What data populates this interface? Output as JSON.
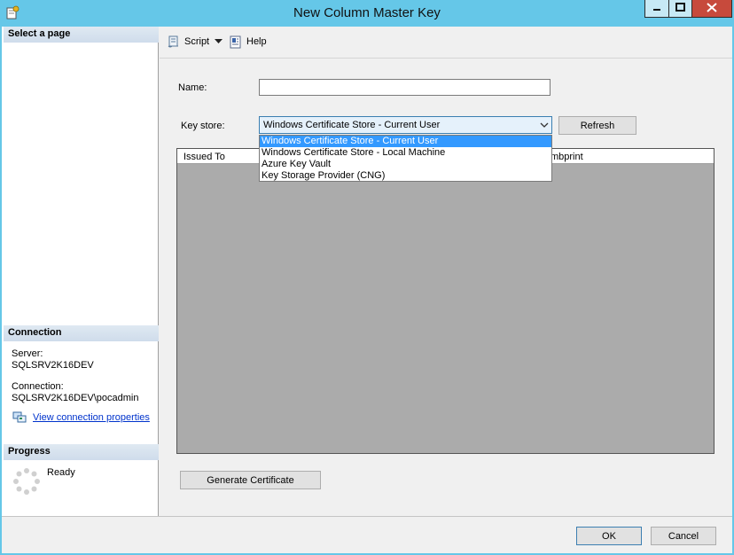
{
  "window": {
    "title": "New Column Master Key",
    "controls": {
      "minimize_icon": "minimize-icon",
      "maximize_icon": "maximize-icon",
      "close_icon": "close-icon"
    }
  },
  "left_panel": {
    "select_page_header": "Select a page",
    "connection": {
      "header": "Connection",
      "server_label": "Server:",
      "server_value": "SQLSRV2K16DEV",
      "connection_label": "Connection:",
      "connection_value": "SQLSRV2K16DEV\\pocadmin",
      "link_text": "View connection properties"
    },
    "progress": {
      "header": "Progress",
      "status": "Ready"
    }
  },
  "toolbar": {
    "script_label": "Script",
    "help_label": "Help"
  },
  "form": {
    "name_label": "Name:",
    "name_value": "",
    "key_store_label": "Key store:",
    "key_store_selected": "Windows Certificate Store - Current User",
    "key_store_options": [
      "Windows Certificate Store - Current User",
      "Windows Certificate Store - Local Machine",
      "Azure Key Vault",
      "Key Storage Provider (CNG)"
    ],
    "refresh_label": "Refresh",
    "grid_columns": [
      "Issued To",
      "mbprint"
    ],
    "generate_label": "Generate Certificate"
  },
  "footer": {
    "ok_label": "OK",
    "cancel_label": "Cancel"
  },
  "colors": {
    "titlebar": "#65c7e8",
    "close_button": "#c74a3c",
    "link": "#0033cc",
    "selection": "#3399ff"
  }
}
